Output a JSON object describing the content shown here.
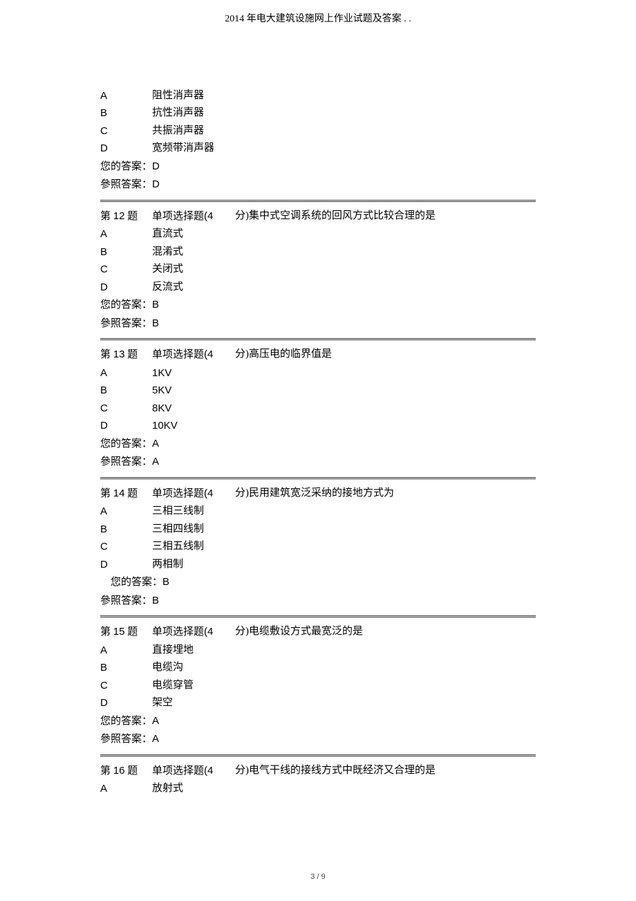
{
  "header": "2014 年电大建筑设施网上作业试题及答案 . .",
  "q11": {
    "optA_letter": "A",
    "optA_text": "阻性消声器",
    "optB_letter": "B",
    "optB_text": "抗性消声器",
    "optC_letter": "C",
    "optC_text": "共振消声器",
    "optD_letter": "D",
    "optD_text": "宽频带消声器",
    "your_label": "您的答案：",
    "your_val": "D",
    "ref_label": "參照答案：",
    "ref_val": "D"
  },
  "q12": {
    "num_prefix": "第 ",
    "num": "12",
    "num_suffix": " 题",
    "type_prefix": "单项选择题",
    "type_points": "(4",
    "type_suffix": "分)",
    "text": "集中式空调系统的回风方式比较合理的是",
    "optA_letter": "A",
    "optA_text": "直流式",
    "optB_letter": "B",
    "optB_text": "混淆式",
    "optC_letter": "C",
    "optC_text": "关闭式",
    "optD_letter": "D",
    "optD_text": "反流式",
    "your_label": "您的答案：",
    "your_val": "B",
    "ref_label": "參照答案：",
    "ref_val": "B"
  },
  "q13": {
    "num_prefix": "第 ",
    "num": "13",
    "num_suffix": " 题",
    "type_prefix": "单项选择题",
    "type_points": "(4",
    "type_suffix": "分)",
    "text": "高压电的临界值是",
    "optA_letter": "A",
    "optA_text": "1KV",
    "optB_letter": "B",
    "optB_text": "5KV",
    "optC_letter": "C",
    "optC_text": "8KV",
    "optD_letter": "D",
    "optD_text": "10KV",
    "your_label": "您的答案：",
    "your_val": "A",
    "ref_label": "參照答案：",
    "ref_val": "A"
  },
  "q14": {
    "num_prefix": "第 ",
    "num": "14",
    "num_suffix": " 题",
    "type_prefix": "单项选择题",
    "type_points": "(4",
    "type_suffix": "分)",
    "text": "民用建筑宽泛采纳的接地方式为",
    "optA_letter": "A",
    "optA_text": "三相三线制",
    "optB_letter": "B",
    "optB_text": "三相四线制",
    "optC_letter": "C",
    "optC_text": "三相五线制",
    "optD_letter": "D",
    "optD_text": "两相制",
    "your_label": "您的答案：",
    "your_val": "B",
    "ref_label": "參照答案：",
    "ref_val": "B"
  },
  "q15": {
    "num_prefix": "第 ",
    "num": "15",
    "num_suffix": " 题",
    "type_prefix": "单项选择题",
    "type_points": "(4",
    "type_suffix": "分)",
    "text": "电缆敷设方式最宽泛的是",
    "optA_letter": "A",
    "optA_text": "直接埋地",
    "optB_letter": "B",
    "optB_text": "电缆沟",
    "optC_letter": "C",
    "optC_text": "电缆穿管",
    "optD_letter": "D",
    "optD_text": "架空",
    "your_label": "您的答案：",
    "your_val": "A",
    "ref_label": "參照答案：",
    "ref_val": "A"
  },
  "q16": {
    "num_prefix": "第 ",
    "num": "16",
    "num_suffix": " 题",
    "type_prefix": "单项选择题",
    "type_points": "(4",
    "type_suffix": "分)",
    "text": "电气干线的接线方式中既经济又合理的是",
    "optA_letter": "A",
    "optA_text": "放射式"
  },
  "footer": "3 / 9"
}
